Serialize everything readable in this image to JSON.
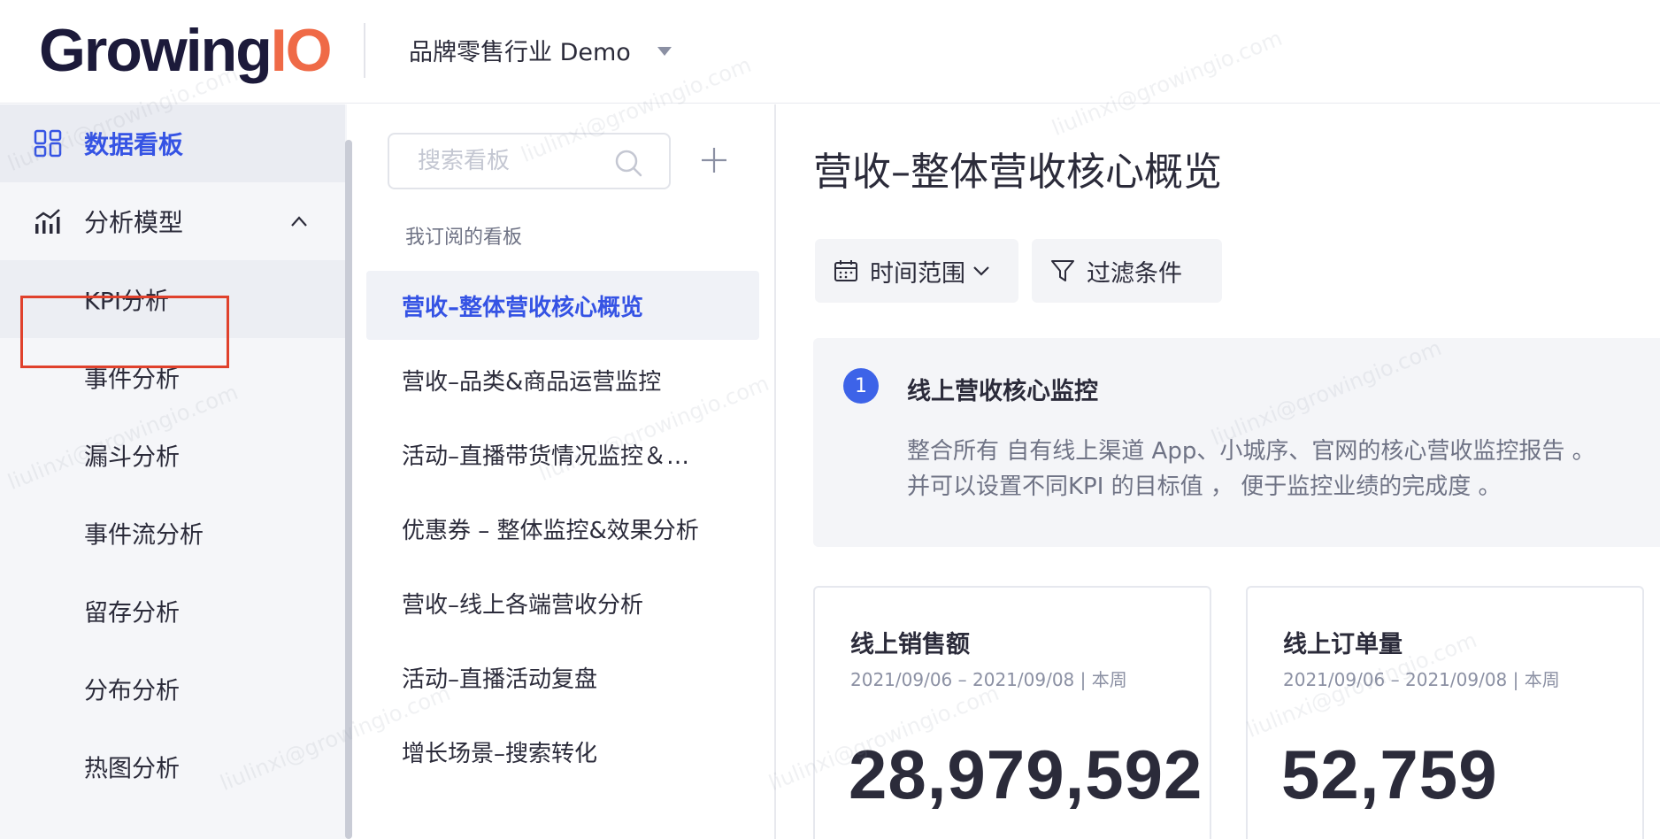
{
  "header": {
    "logo_main": "Growing",
    "logo_accent": "IO",
    "project_name": "品牌零售行业 Demo"
  },
  "sidebar": {
    "items": [
      {
        "label": "数据看板",
        "icon": "dashboard-icon",
        "active": true
      },
      {
        "label": "分析模型",
        "icon": "analysis-chart-icon",
        "expanded": true
      }
    ],
    "sub_items": [
      {
        "label": "KPI分析",
        "selected": true
      },
      {
        "label": "事件分析"
      },
      {
        "label": "漏斗分析"
      },
      {
        "label": "事件流分析"
      },
      {
        "label": "留存分析"
      },
      {
        "label": "分布分析"
      },
      {
        "label": "热图分析"
      }
    ]
  },
  "dashboards": {
    "search_placeholder": "搜索看板",
    "section_label": "我订阅的看板",
    "items": [
      {
        "label": "营收–整体营收核心概览",
        "active": true
      },
      {
        "label": "营收–品类&商品运营监控"
      },
      {
        "label": "活动–直播带货情况监控＆…"
      },
      {
        "label": "优惠券 – 整体监控&效果分析"
      },
      {
        "label": "营收–线上各端营收分析"
      },
      {
        "label": "活动–直播活动复盘"
      },
      {
        "label": "增长场景–搜索转化"
      }
    ]
  },
  "main": {
    "title": "营收–整体营收核心概览",
    "time_range_label": "时间范围",
    "filter_label": "过滤条件",
    "section": {
      "number": "1",
      "title": "线上营收核心监控",
      "desc_line1": "整合所有 自有线上渠道 App、小城序、官网的核心营收监控报告 。",
      "desc_line2": "并可以设置不同KPI 的目标值 ， 便于监控业绩的完成度 。"
    },
    "kpis": [
      {
        "title": "线上销售额",
        "range": "2021/09/06 – 2021/09/08 | 本周",
        "value": "28,979,592"
      },
      {
        "title": "线上订单量",
        "range": "2021/09/06 – 2021/09/08 | 本周",
        "value": "52,759"
      }
    ]
  },
  "watermark_text": "liulinxi@growingio.com",
  "colors": {
    "accent_blue": "#3553e4",
    "logo_orange": "#ef6a47",
    "highlight_red": "#e0412c",
    "badge_blue": "#3d63e8"
  }
}
